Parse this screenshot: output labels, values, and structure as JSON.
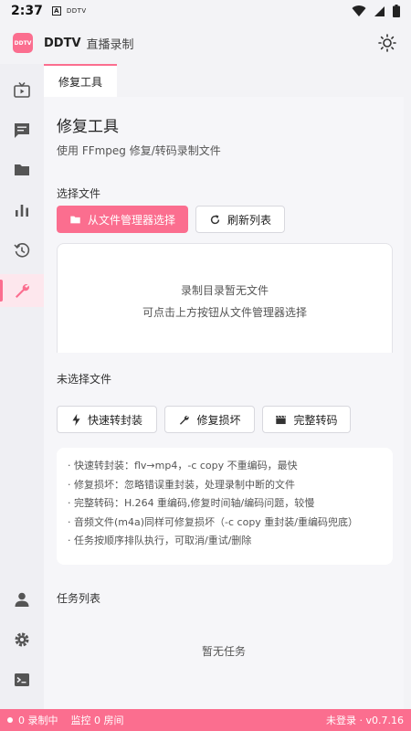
{
  "status_bar": {
    "time": "2:37",
    "notif_a": "A",
    "notif_app": "DDTV"
  },
  "app_bar": {
    "logo": "DDTV",
    "title": "DDTV",
    "subtitle": "直播录制"
  },
  "sidebar": {
    "items": [
      {
        "icon": "live-tv-icon"
      },
      {
        "icon": "chat-icon"
      },
      {
        "icon": "folder-icon"
      },
      {
        "icon": "bar-chart-icon"
      },
      {
        "icon": "history-icon"
      },
      {
        "icon": "wrench-icon",
        "active": true
      },
      {
        "icon": "person-icon"
      },
      {
        "icon": "gear-icon"
      },
      {
        "icon": "terminal-icon"
      }
    ]
  },
  "tab": {
    "label": "修复工具"
  },
  "page": {
    "title": "修复工具",
    "description": "使用 FFmpeg 修复/转码录制文件",
    "select_file_label": "选择文件",
    "pick_button": "从文件管理器选择",
    "refresh_button": "刷新列表",
    "empty_line1": "录制目录暂无文件",
    "empty_line2": "可点击上方按钮从文件管理器选择",
    "no_file_selected": "未选择文件",
    "actions": {
      "quick": "快速转封装",
      "repair": "修复损坏",
      "full": "完整转码"
    },
    "tips": [
      "· 快速转封装：flv→mp4，-c copy 不重编码，最快",
      "· 修复损坏：忽略错误重封装，处理录制中断的文件",
      "· 完整转码：H.264 重编码,修复时间轴/编码问题，较慢",
      "· 音频文件(m4a)同样可修复损坏（-c copy 重封装/重编码兜底）",
      "· 任务按顺序排队执行，可取消/重试/删除"
    ],
    "task_list_label": "任务列表",
    "no_tasks": "暂无任务"
  },
  "bottom_bar": {
    "recording": "0 录制中",
    "monitoring": "监控 0 房间",
    "login_version": "未登录 · v0.7.16"
  },
  "colors": {
    "accent": "#fb6e8f",
    "background": "#f3f3f6",
    "card": "#ffffff"
  }
}
